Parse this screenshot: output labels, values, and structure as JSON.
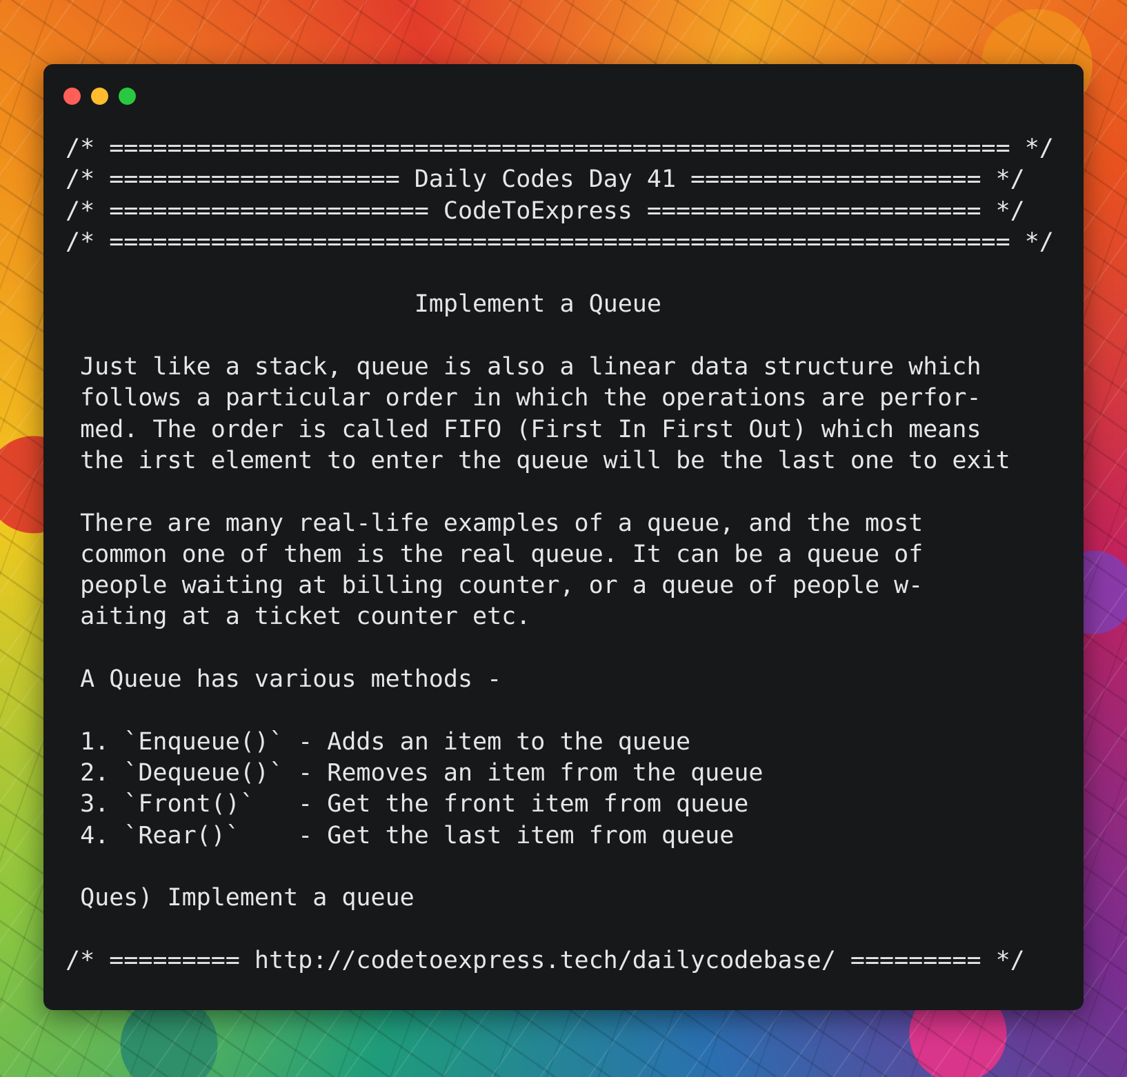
{
  "window_controls": [
    "close",
    "minimize",
    "maximize"
  ],
  "code_lines": [
    "/* ============================================================== */",
    "/* ==================== Daily Codes Day 41 ==================== */",
    "/* ====================== CodeToExpress ======================= */",
    "/* ============================================================== */",
    "",
    "                        Implement a Queue",
    "",
    " Just like a stack, queue is also a linear data structure which",
    " follows a particular order in which the operations are perfor-",
    " med. The order is called FIFO (First In First Out) which means",
    " the irst element to enter the queue will be the last one to exit",
    "",
    " There are many real-life examples of a queue, and the most",
    " common one of them is the real queue. It can be a queue of",
    " people waiting at billing counter, or a queue of people w-",
    " aiting at a ticket counter etc.",
    "",
    " A Queue has various methods -",
    "",
    " 1. `Enqueue()` - Adds an item to the queue",
    " 2. `Dequeue()` - Removes an item from the queue",
    " 3. `Front()`   - Get the front item from queue",
    " 4. `Rear()`    - Get the last item from queue",
    "",
    " Ques) Implement a queue",
    "",
    "/* ========= http://codetoexpress.tech/dailycodebase/ ========= */"
  ]
}
